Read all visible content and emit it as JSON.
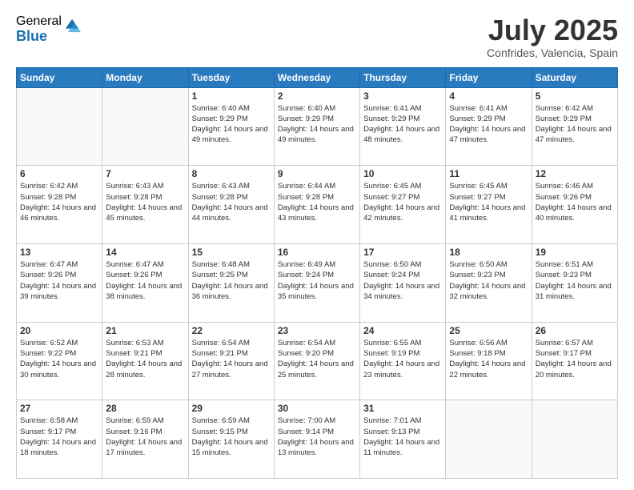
{
  "logo": {
    "general": "General",
    "blue": "Blue"
  },
  "header": {
    "month": "July 2025",
    "location": "Confrides, Valencia, Spain"
  },
  "weekdays": [
    "Sunday",
    "Monday",
    "Tuesday",
    "Wednesday",
    "Thursday",
    "Friday",
    "Saturday"
  ],
  "weeks": [
    [
      {
        "day": "",
        "sunrise": "",
        "sunset": "",
        "daylight": ""
      },
      {
        "day": "",
        "sunrise": "",
        "sunset": "",
        "daylight": ""
      },
      {
        "day": "1",
        "sunrise": "Sunrise: 6:40 AM",
        "sunset": "Sunset: 9:29 PM",
        "daylight": "Daylight: 14 hours and 49 minutes."
      },
      {
        "day": "2",
        "sunrise": "Sunrise: 6:40 AM",
        "sunset": "Sunset: 9:29 PM",
        "daylight": "Daylight: 14 hours and 49 minutes."
      },
      {
        "day": "3",
        "sunrise": "Sunrise: 6:41 AM",
        "sunset": "Sunset: 9:29 PM",
        "daylight": "Daylight: 14 hours and 48 minutes."
      },
      {
        "day": "4",
        "sunrise": "Sunrise: 6:41 AM",
        "sunset": "Sunset: 9:29 PM",
        "daylight": "Daylight: 14 hours and 47 minutes."
      },
      {
        "day": "5",
        "sunrise": "Sunrise: 6:42 AM",
        "sunset": "Sunset: 9:29 PM",
        "daylight": "Daylight: 14 hours and 47 minutes."
      }
    ],
    [
      {
        "day": "6",
        "sunrise": "Sunrise: 6:42 AM",
        "sunset": "Sunset: 9:28 PM",
        "daylight": "Daylight: 14 hours and 46 minutes."
      },
      {
        "day": "7",
        "sunrise": "Sunrise: 6:43 AM",
        "sunset": "Sunset: 9:28 PM",
        "daylight": "Daylight: 14 hours and 45 minutes."
      },
      {
        "day": "8",
        "sunrise": "Sunrise: 6:43 AM",
        "sunset": "Sunset: 9:28 PM",
        "daylight": "Daylight: 14 hours and 44 minutes."
      },
      {
        "day": "9",
        "sunrise": "Sunrise: 6:44 AM",
        "sunset": "Sunset: 9:28 PM",
        "daylight": "Daylight: 14 hours and 43 minutes."
      },
      {
        "day": "10",
        "sunrise": "Sunrise: 6:45 AM",
        "sunset": "Sunset: 9:27 PM",
        "daylight": "Daylight: 14 hours and 42 minutes."
      },
      {
        "day": "11",
        "sunrise": "Sunrise: 6:45 AM",
        "sunset": "Sunset: 9:27 PM",
        "daylight": "Daylight: 14 hours and 41 minutes."
      },
      {
        "day": "12",
        "sunrise": "Sunrise: 6:46 AM",
        "sunset": "Sunset: 9:26 PM",
        "daylight": "Daylight: 14 hours and 40 minutes."
      }
    ],
    [
      {
        "day": "13",
        "sunrise": "Sunrise: 6:47 AM",
        "sunset": "Sunset: 9:26 PM",
        "daylight": "Daylight: 14 hours and 39 minutes."
      },
      {
        "day": "14",
        "sunrise": "Sunrise: 6:47 AM",
        "sunset": "Sunset: 9:26 PM",
        "daylight": "Daylight: 14 hours and 38 minutes."
      },
      {
        "day": "15",
        "sunrise": "Sunrise: 6:48 AM",
        "sunset": "Sunset: 9:25 PM",
        "daylight": "Daylight: 14 hours and 36 minutes."
      },
      {
        "day": "16",
        "sunrise": "Sunrise: 6:49 AM",
        "sunset": "Sunset: 9:24 PM",
        "daylight": "Daylight: 14 hours and 35 minutes."
      },
      {
        "day": "17",
        "sunrise": "Sunrise: 6:50 AM",
        "sunset": "Sunset: 9:24 PM",
        "daylight": "Daylight: 14 hours and 34 minutes."
      },
      {
        "day": "18",
        "sunrise": "Sunrise: 6:50 AM",
        "sunset": "Sunset: 9:23 PM",
        "daylight": "Daylight: 14 hours and 32 minutes."
      },
      {
        "day": "19",
        "sunrise": "Sunrise: 6:51 AM",
        "sunset": "Sunset: 9:23 PM",
        "daylight": "Daylight: 14 hours and 31 minutes."
      }
    ],
    [
      {
        "day": "20",
        "sunrise": "Sunrise: 6:52 AM",
        "sunset": "Sunset: 9:22 PM",
        "daylight": "Daylight: 14 hours and 30 minutes."
      },
      {
        "day": "21",
        "sunrise": "Sunrise: 6:53 AM",
        "sunset": "Sunset: 9:21 PM",
        "daylight": "Daylight: 14 hours and 28 minutes."
      },
      {
        "day": "22",
        "sunrise": "Sunrise: 6:54 AM",
        "sunset": "Sunset: 9:21 PM",
        "daylight": "Daylight: 14 hours and 27 minutes."
      },
      {
        "day": "23",
        "sunrise": "Sunrise: 6:54 AM",
        "sunset": "Sunset: 9:20 PM",
        "daylight": "Daylight: 14 hours and 25 minutes."
      },
      {
        "day": "24",
        "sunrise": "Sunrise: 6:55 AM",
        "sunset": "Sunset: 9:19 PM",
        "daylight": "Daylight: 14 hours and 23 minutes."
      },
      {
        "day": "25",
        "sunrise": "Sunrise: 6:56 AM",
        "sunset": "Sunset: 9:18 PM",
        "daylight": "Daylight: 14 hours and 22 minutes."
      },
      {
        "day": "26",
        "sunrise": "Sunrise: 6:57 AM",
        "sunset": "Sunset: 9:17 PM",
        "daylight": "Daylight: 14 hours and 20 minutes."
      }
    ],
    [
      {
        "day": "27",
        "sunrise": "Sunrise: 6:58 AM",
        "sunset": "Sunset: 9:17 PM",
        "daylight": "Daylight: 14 hours and 18 minutes."
      },
      {
        "day": "28",
        "sunrise": "Sunrise: 6:59 AM",
        "sunset": "Sunset: 9:16 PM",
        "daylight": "Daylight: 14 hours and 17 minutes."
      },
      {
        "day": "29",
        "sunrise": "Sunrise: 6:59 AM",
        "sunset": "Sunset: 9:15 PM",
        "daylight": "Daylight: 14 hours and 15 minutes."
      },
      {
        "day": "30",
        "sunrise": "Sunrise: 7:00 AM",
        "sunset": "Sunset: 9:14 PM",
        "daylight": "Daylight: 14 hours and 13 minutes."
      },
      {
        "day": "31",
        "sunrise": "Sunrise: 7:01 AM",
        "sunset": "Sunset: 9:13 PM",
        "daylight": "Daylight: 14 hours and 11 minutes."
      },
      {
        "day": "",
        "sunrise": "",
        "sunset": "",
        "daylight": ""
      },
      {
        "day": "",
        "sunrise": "",
        "sunset": "",
        "daylight": ""
      }
    ]
  ]
}
